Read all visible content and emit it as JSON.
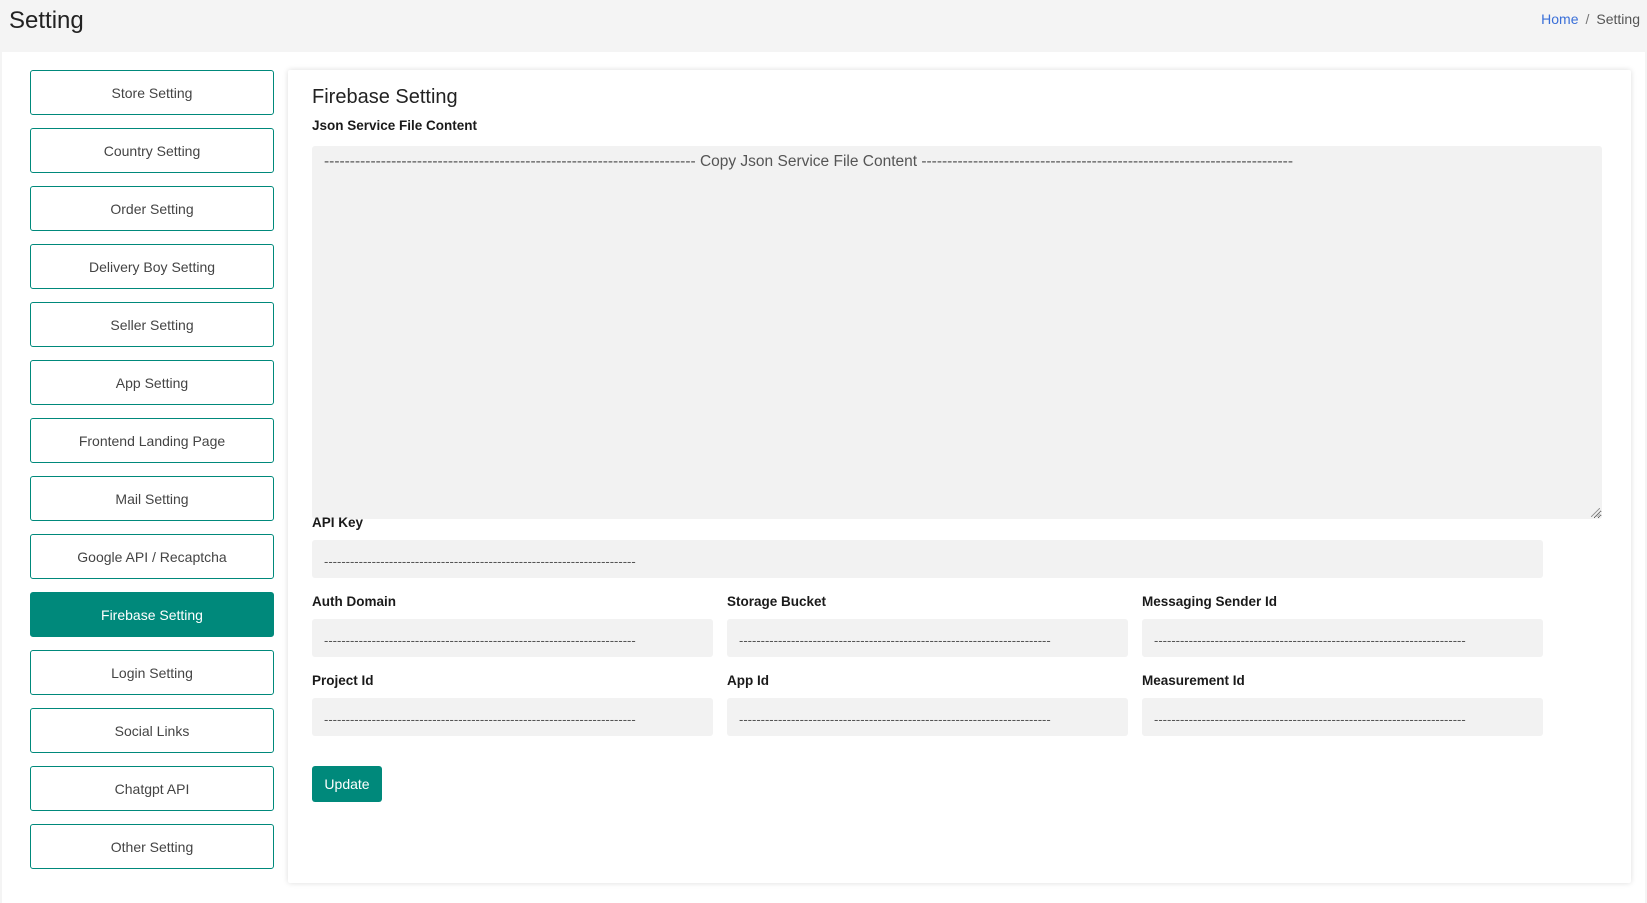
{
  "header": {
    "title": "Setting",
    "breadcrumb": {
      "home": "Home",
      "separator": "/",
      "current": "Setting"
    }
  },
  "sidebar": {
    "items": [
      {
        "label": "Store Setting",
        "active": false
      },
      {
        "label": "Country Setting",
        "active": false
      },
      {
        "label": "Order Setting",
        "active": false
      },
      {
        "label": "Delivery Boy Setting",
        "active": false
      },
      {
        "label": "Seller Setting",
        "active": false
      },
      {
        "label": "App Setting",
        "active": false
      },
      {
        "label": "Frontend Landing Page",
        "active": false
      },
      {
        "label": "Mail Setting",
        "active": false
      },
      {
        "label": "Google API / Recaptcha",
        "active": false
      },
      {
        "label": "Firebase Setting",
        "active": true
      },
      {
        "label": "Login Setting",
        "active": false
      },
      {
        "label": "Social Links",
        "active": false
      },
      {
        "label": "Chatgpt API",
        "active": false
      },
      {
        "label": "Other Setting",
        "active": false
      }
    ]
  },
  "form": {
    "title": "Firebase Setting",
    "json_label": "Json Service File Content",
    "json_placeholder": "------------------------------------------------------------------------ Copy Json Service File Content ------------------------------------------------------------------------",
    "api_key": {
      "label": "API Key",
      "placeholder": "------------------------------------------------------------------------"
    },
    "auth_domain": {
      "label": "Auth Domain",
      "placeholder": "------------------------------------------------------------------------"
    },
    "storage_bucket": {
      "label": "Storage Bucket",
      "placeholder": "------------------------------------------------------------------------"
    },
    "messaging_sender_id": {
      "label": "Messaging Sender Id",
      "placeholder": "------------------------------------------------------------------------"
    },
    "project_id": {
      "label": "Project Id",
      "placeholder": "------------------------------------------------------------------------"
    },
    "app_id": {
      "label": "App Id",
      "placeholder": "------------------------------------------------------------------------"
    },
    "measurement_id": {
      "label": "Measurement Id",
      "placeholder": "------------------------------------------------------------------------"
    },
    "update_label": "Update"
  },
  "colors": {
    "accent": "#00897b",
    "link": "#3a6fd8",
    "input_bg": "#f2f2f2",
    "page_bg": "#f4f4f4"
  }
}
